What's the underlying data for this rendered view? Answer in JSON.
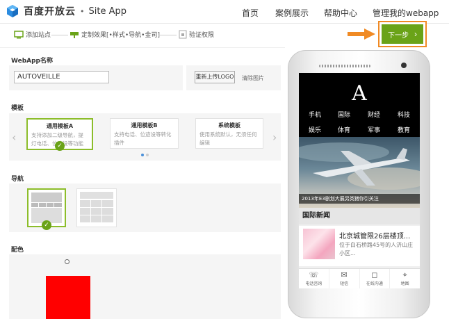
{
  "header": {
    "logo_text": "百度开放云",
    "logo_sep": "•",
    "logo_sub": "Site App",
    "nav": [
      "首页",
      "案例展示",
      "帮助中心",
      "管理我的webapp"
    ]
  },
  "steps": [
    {
      "label": "添加站点",
      "icon": "monitor-icon"
    },
    {
      "label": "定制效果[•样式•导航•金司]",
      "icon": "paint-icon"
    },
    {
      "label": "验证权限",
      "icon": "lock-icon"
    }
  ],
  "next_button": {
    "label": "下一步",
    "chevron": "›"
  },
  "webapp_name": {
    "label": "WebApp名称",
    "value": "AUTOVEILLE"
  },
  "logo": {
    "upload_label": "重新上传LOGO",
    "clear_label": "清除图片"
  },
  "template": {
    "label": "模板",
    "cards": [
      {
        "title": "通用模板A",
        "desc": "支持添加二级导航，提灯电话、位迹设等功能",
        "selected": true
      },
      {
        "title": "通用模板B",
        "desc": "支持电话、位迹设等转化插件",
        "selected": false
      },
      {
        "title": "系统模板",
        "desc": "使用系统默认，无须任何编辑",
        "selected": false
      }
    ],
    "prev": "‹",
    "next": "›"
  },
  "nav_section": {
    "label": "导航"
  },
  "color_section": {
    "label": "配色"
  },
  "colors": {
    "accent": "#6aa318",
    "highlight": "#f08a24",
    "swatch": "#ff0000"
  },
  "phone": {
    "title": "A",
    "nav_rows": [
      [
        "手机",
        "国际",
        "财经",
        "科技"
      ],
      [
        "娱乐",
        "体育",
        "军事",
        "教育"
      ]
    ],
    "hero_caption": "2013年E3剧划大展另类猪你引关注",
    "news_header": "国际新闻",
    "news_title": "北京城管限26层楼顶...",
    "news_desc": "位于白石桥路45号的人济山庄小区...",
    "bottom_items": [
      {
        "icon": "phone-icon",
        "glyph": "☏",
        "label": "电话咨询"
      },
      {
        "icon": "message-icon",
        "glyph": "✉",
        "label": "短信"
      },
      {
        "icon": "chat-icon",
        "glyph": "◻",
        "label": "在线沟通"
      },
      {
        "icon": "map-pin-icon",
        "glyph": "⌖",
        "label": "地图"
      }
    ]
  }
}
